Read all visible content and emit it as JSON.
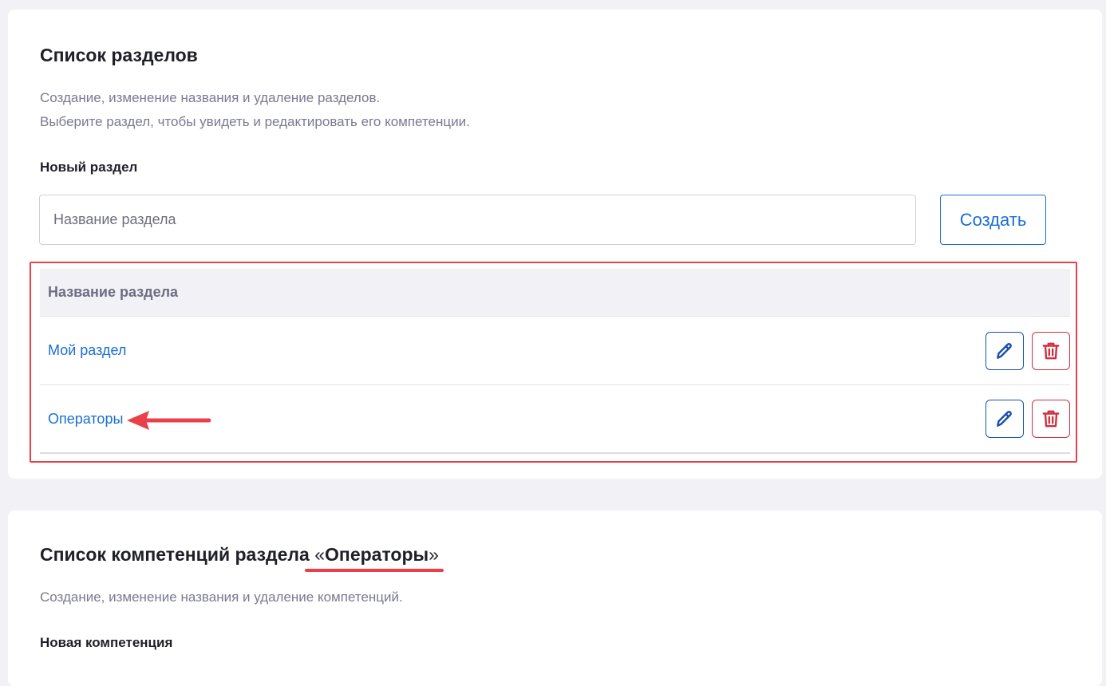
{
  "sections_card": {
    "title": "Список разделов",
    "description_line1": "Создание, изменение названия и удаление разделов.",
    "description_line2": "Выберите раздел, чтобы увидеть и редактировать его компетенции.",
    "new_label": "Новый раздел",
    "input_placeholder": "Название раздела",
    "create_button": "Создать",
    "table_header": "Название раздела",
    "rows": [
      {
        "name": "Мой раздел"
      },
      {
        "name": "Операторы"
      }
    ]
  },
  "competencies_card": {
    "title_prefix": "Список компетенций раздела",
    "quote_open": "«",
    "section_name": "Операторы",
    "quote_close": "»",
    "description": "Создание, изменение названия и удаление компетенций.",
    "new_label": "Новая компетенция"
  },
  "colors": {
    "accent_blue": "#1a6fd1",
    "delete_red": "#d03040",
    "annotation_red": "#e8404a"
  },
  "icons": {
    "edit": "pencil-icon",
    "delete": "trash-icon",
    "annotation": "arrow-left-icon"
  }
}
